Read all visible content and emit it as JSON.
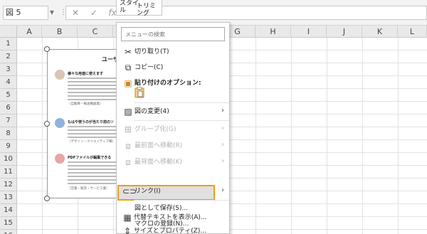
{
  "formula_bar": {
    "name_box": "図 5",
    "cancel_icon": "✕",
    "enter_icon": "✓",
    "fx_label": "fx"
  },
  "mini_toolbar": {
    "style_label": "スタイ\nル",
    "crop_label": "トリミング"
  },
  "columns": [
    "A",
    "B",
    "C",
    "D",
    "E",
    "F",
    "G",
    "H",
    "I",
    "J",
    "K",
    "L"
  ],
  "rows": [
    "1",
    "2",
    "3",
    "4",
    "5",
    "6",
    "7",
    "8",
    "9",
    "10",
    "11",
    "12",
    "13",
    "14",
    "15",
    "16"
  ],
  "picture": {
    "title": "ユーザ",
    "features": [
      {
        "title": "様々な用途に使えます",
        "caption": "（自動車・輸送機器業）"
      },
      {
        "title": "もはや使うのが当たり前のソ",
        "caption": "（デザイン・クリエイティブ職）"
      },
      {
        "title": "PDFファイルが編集できる",
        "caption": "（営業・販売・サービス業）"
      }
    ]
  },
  "context_menu": {
    "search_placeholder": "メニューの検索",
    "items": [
      {
        "label": "切り取り(T)",
        "icon": "scissors-icon",
        "enabled": true
      },
      {
        "label": "コピー(C)",
        "icon": "copy-icon",
        "enabled": true
      },
      {
        "label": "貼り付けのオプション:",
        "icon": "paste-icon",
        "enabled": true
      },
      {
        "label": "図の変更(4)",
        "icon": "change-picture-icon",
        "enabled": true,
        "submenu": true
      },
      {
        "label": "グループ化(G)",
        "icon": "group-icon",
        "enabled": false,
        "submenu": true
      },
      {
        "label": "最前面へ移動(R)",
        "icon": "bring-front-icon",
        "enabled": false,
        "submenu": true
      },
      {
        "label": "最背面へ移動(K)",
        "icon": "send-back-icon",
        "enabled": false,
        "submenu": true
      },
      {
        "label": "リンク(I)",
        "icon": "link-icon",
        "enabled": true,
        "submenu": true,
        "highlighted": true
      },
      {
        "label": "図として保存(S)...",
        "icon": "",
        "enabled": true
      },
      {
        "label": "マクロの登録(N)...",
        "icon": "",
        "enabled": true
      },
      {
        "label": "代替テキストを表示(A)...",
        "icon": "alt-text-icon",
        "enabled": true
      },
      {
        "label": "サイズとプロパティ(Z)...",
        "icon": "size-properties-icon",
        "enabled": true
      }
    ]
  },
  "colors": {
    "highlight_border": "#f39c12",
    "highlight_bg": "#e0e0e0"
  }
}
